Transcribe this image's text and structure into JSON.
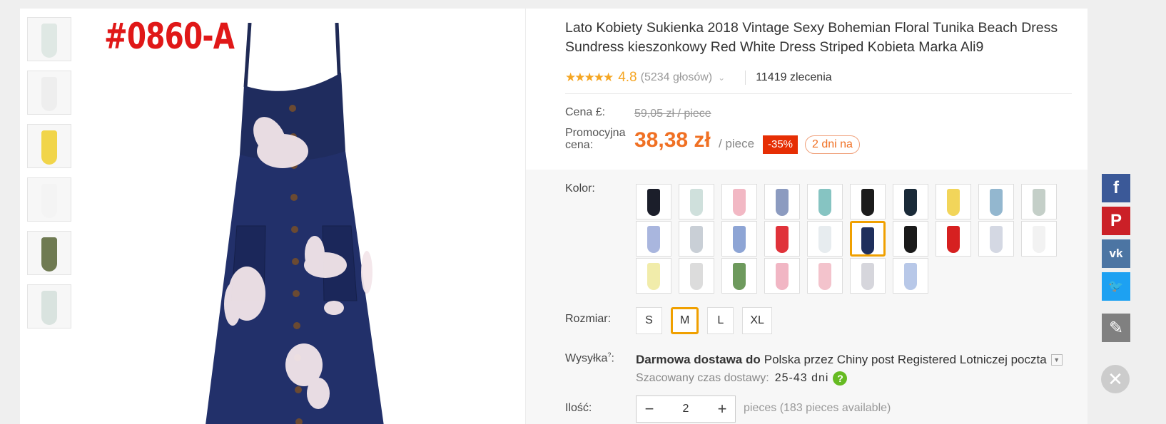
{
  "product": {
    "sku_code": "#0860-A",
    "title": "Lato Kobiety Sukienka 2018 Vintage Sexy Bohemian Floral Tunika Beach Dress Sundress kieszonkowy Red White Dress Striped Kobieta Marka Ali9",
    "stars": "★★★★★",
    "rating": "4.8",
    "votes": "(5234 głosów)",
    "orders": "11419 zlecenia"
  },
  "thumbnails": [
    {
      "icon": "floral-white-dress-thumb",
      "color": "#dfe8e4"
    },
    {
      "icon": "white-dress-thumb",
      "color": "#eeeeee"
    },
    {
      "icon": "yellow-dress-thumb",
      "color": "#f1d54a"
    },
    {
      "icon": "white-dress-model-thumb",
      "color": "#f4f4f4"
    },
    {
      "icon": "green-dress-model-thumb",
      "color": "#6f7a52"
    },
    {
      "icon": "floral-dress-thumb",
      "color": "#d9e3df"
    }
  ],
  "price": {
    "label_price": "Cena £:",
    "old_price": "59,05 zł / piece",
    "label_promo": "Promocyjna cena:",
    "new_price": "38,38 zł",
    "per_piece": "/ piece",
    "discount": "-35%",
    "days_left": "2 dni na"
  },
  "options": {
    "color_label": "Kolor:",
    "colors": [
      "#1b1e2a",
      "#cfe0dc",
      "#f2b8c4",
      "#8c9bc0",
      "#86c4c2",
      "#1c1c1c",
      "#1a2a38",
      "#f2d55a",
      "#93b7cf",
      "#c4cfc8",
      "#a9b6de",
      "#c9cfd6",
      "#8ea5d5",
      "#e0323a",
      "#e7ecef",
      "#1f2f5c",
      "#1a1a1a",
      "#d62020",
      "#d4d8e3",
      "#f2f2f2",
      "#f1ecaa",
      "#dcdcdc",
      "#6e9a5d",
      "#f1b6c4",
      "#f3c3cc",
      "#d6d6dc",
      "#b8c8e8"
    ],
    "selected_color_index": 15,
    "size_label": "Rozmiar:",
    "sizes": [
      "S",
      "M",
      "L",
      "XL"
    ],
    "selected_size": "M"
  },
  "shipping": {
    "label": "Wysyłka",
    "free_text": "Darmowa dostawa do",
    "dest_text": "Polska przez Chiny post Registered Lotniczej poczta",
    "eta_label": "Szacowany czas dostawy:",
    "eta_value": "25-43 dni"
  },
  "quantity": {
    "label": "Ilość:",
    "minus": "−",
    "value": "2",
    "plus": "+",
    "available": "pieces (183 pieces available)"
  },
  "social": [
    {
      "icon": "facebook-icon",
      "glyph": "f",
      "color": "#3b5998"
    },
    {
      "icon": "pinterest-icon",
      "glyph": "P",
      "color": "#cb2027"
    },
    {
      "icon": "vk-icon",
      "glyph": "vk",
      "color": "#4c75a3"
    },
    {
      "icon": "twitter-icon",
      "glyph": "🐦",
      "color": "#1da1f2"
    },
    {
      "icon": "edit-icon",
      "glyph": "✎",
      "color": "#808080"
    }
  ]
}
